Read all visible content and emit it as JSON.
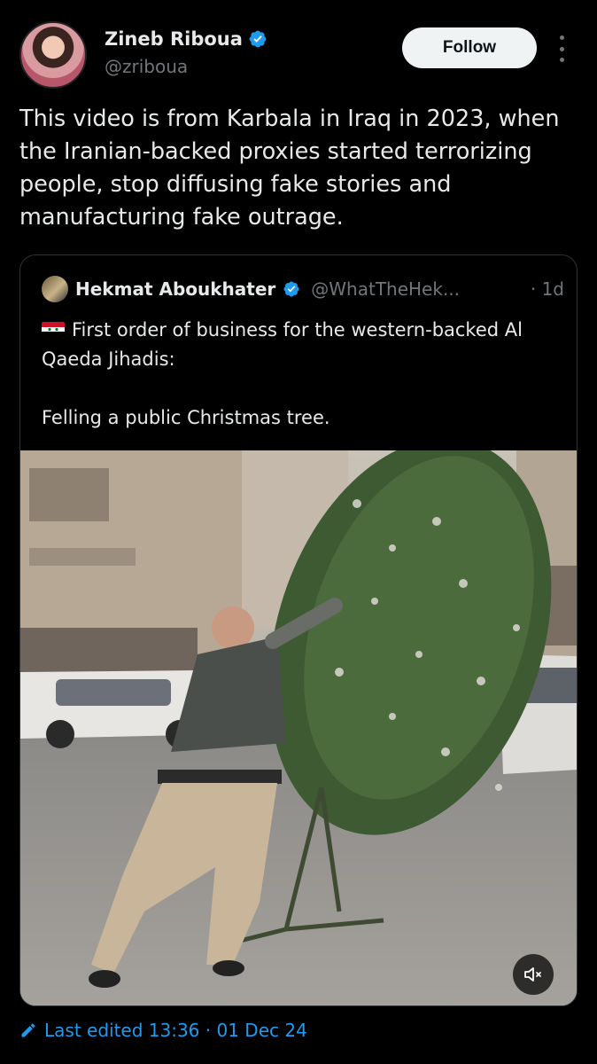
{
  "author": {
    "display_name": "Zineb Riboua",
    "handle": "@zriboua",
    "verified_icon": "verified-badge-icon",
    "follow_label": "Follow"
  },
  "tweet": {
    "text": "This video is from Karbala in Iraq in 2023, when the Iranian-backed proxies started terrorizing people, stop diffusing fake stories and manufacturing fake outrage."
  },
  "quoted": {
    "display_name": "Hekmat Aboukhater",
    "handle": "@WhatTheHek...",
    "time": "· 1d",
    "flag_icon": "syria-flag-icon",
    "line1": "First order of business for the western-backed Al Qaeda Jihadis:",
    "line2": "Felling a public Christmas tree."
  },
  "footer": {
    "edited_label": "Last edited 13:36 · 01 Dec 24"
  },
  "colors": {
    "background": "#000000",
    "accent": "#1d9bf0",
    "text": "#e7e9ea",
    "muted": "#71767b",
    "border": "#2f3336"
  }
}
